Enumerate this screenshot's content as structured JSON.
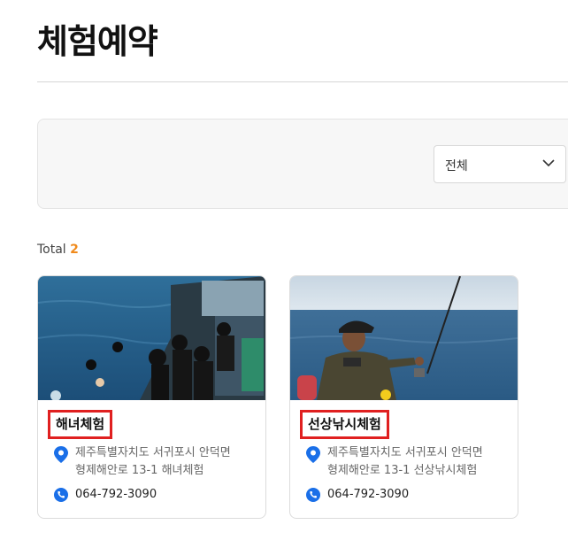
{
  "page": {
    "title": "체험예약"
  },
  "filter": {
    "selected": "전체"
  },
  "summary": {
    "total_label": "Total",
    "total_count": "2"
  },
  "cards": [
    {
      "title": "해녀체험",
      "address_line1": "제주특별자치도 서귀포시 안덕면",
      "address_line2": "형제해안로 13-1 해녀체험",
      "phone": "064-792-3090"
    },
    {
      "title": "선상낚시체험",
      "address_line1": "제주특별자치도 서귀포시 안덕면",
      "address_line2": "형제해안로 13-1 선상낚시체험",
      "phone": "064-792-3090"
    }
  ],
  "colors": {
    "accent": "#f08a1c",
    "highlight_border": "#e02020",
    "icon_blue": "#1a6fe8"
  },
  "icons": {
    "select": "chevron-down-icon",
    "address": "location-pin-icon",
    "phone": "phone-icon"
  }
}
